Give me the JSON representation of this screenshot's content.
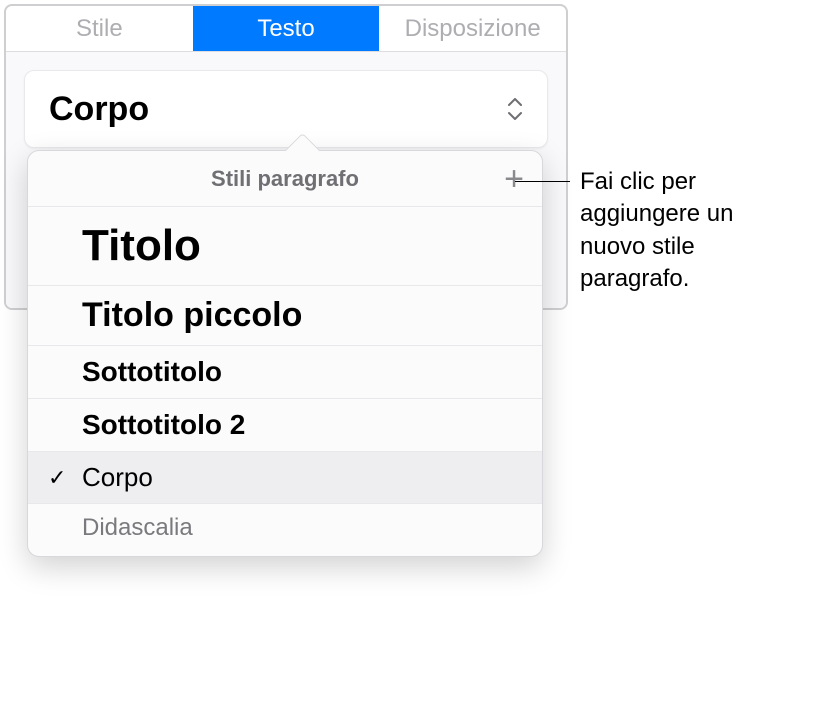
{
  "tabs": {
    "stile": "Stile",
    "testo": "Testo",
    "disposizione": "Disposizione"
  },
  "styleSelect": {
    "current": "Corpo"
  },
  "popover": {
    "title": "Stili paragrafo",
    "items": [
      {
        "label": "Titolo",
        "selected": false,
        "cls": "s-titolo"
      },
      {
        "label": "Titolo piccolo",
        "selected": false,
        "cls": "s-titolopiccolo"
      },
      {
        "label": "Sottotitolo",
        "selected": false,
        "cls": "s-sottotitolo"
      },
      {
        "label": "Sottotitolo 2",
        "selected": false,
        "cls": "s-sottotitolo2"
      },
      {
        "label": "Corpo",
        "selected": true,
        "cls": "s-corpo"
      },
      {
        "label": "Didascalia",
        "selected": false,
        "cls": "s-didascalia"
      }
    ]
  },
  "callout": "Fai clic per aggiungere un nuovo stile paragrafo."
}
